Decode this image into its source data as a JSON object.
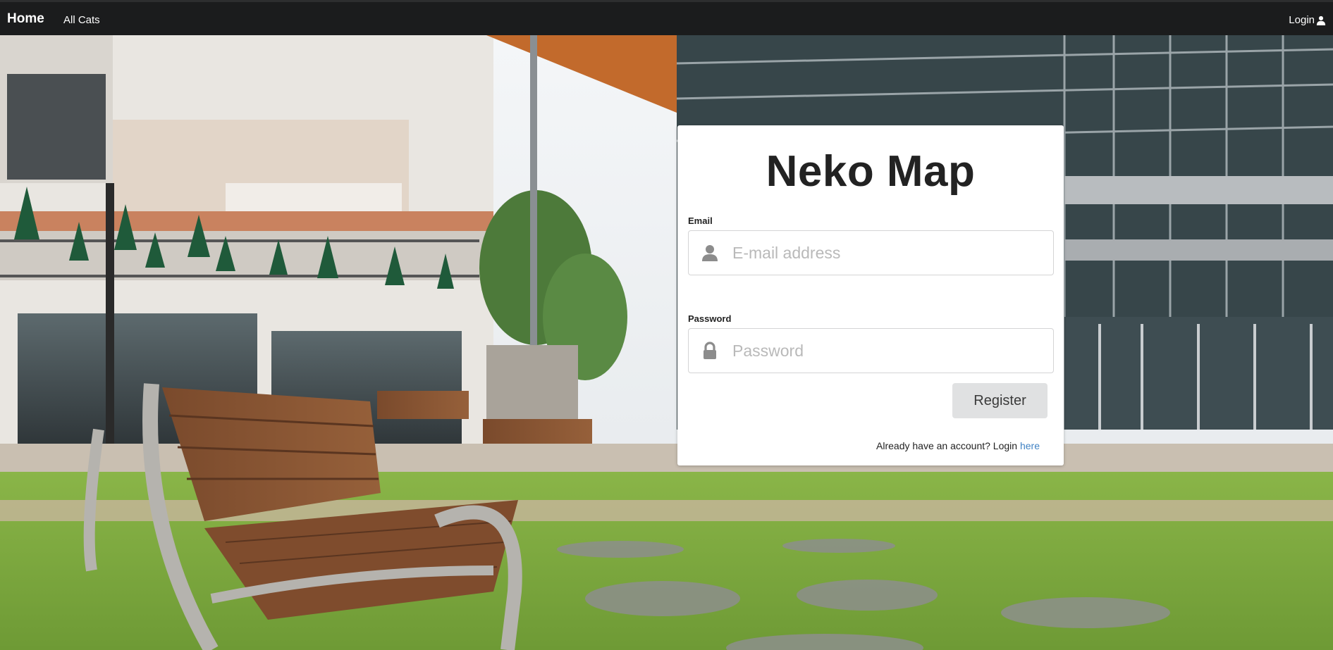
{
  "navbar": {
    "home_label": "Home",
    "all_cats_label": "All Cats",
    "login_label": "Login",
    "login_icon": "user-icon"
  },
  "card": {
    "title": "Neko Map",
    "email": {
      "label": "Email",
      "placeholder": "E-mail address",
      "value": "",
      "icon": "user-icon"
    },
    "password": {
      "label": "Password",
      "placeholder": "Password",
      "value": "",
      "icon": "lock-icon"
    },
    "register_label": "Register",
    "already_text": "Already have an account? Login ",
    "here_link": "here"
  },
  "colors": {
    "navbar_bg": "#1b1c1d",
    "button_bg": "#e0e1e2",
    "link": "#4183c4"
  }
}
